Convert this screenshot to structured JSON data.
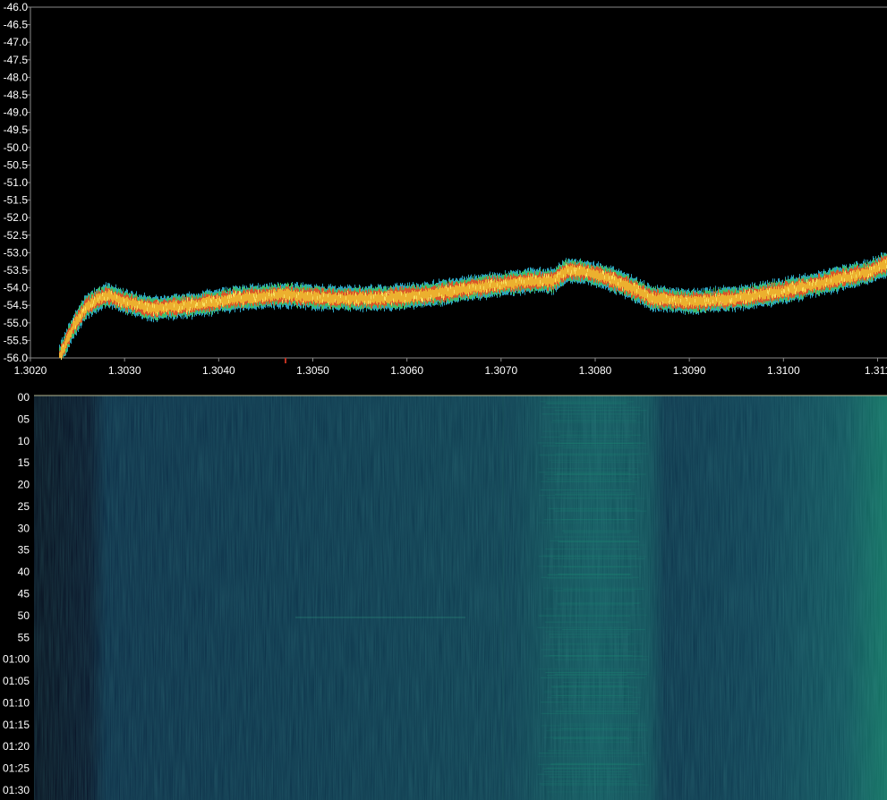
{
  "spectrum": {
    "y_ticks": [
      "-46.0",
      "-46.5",
      "-47.0",
      "-47.5",
      "-48.0",
      "-48.5",
      "-49.0",
      "-49.5",
      "-50.0",
      "-50.5",
      "-51.0",
      "-51.5",
      "-52.0",
      "-52.5",
      "-53.0",
      "-53.5",
      "-54.0",
      "-54.5",
      "-55.0",
      "-55.5",
      "-56.0"
    ],
    "x_ticks": [
      "1.3020",
      "1.3030",
      "1.3040",
      "1.3050",
      "1.3060",
      "1.3070",
      "1.3080",
      "1.3090",
      "1.3100",
      "1.311"
    ],
    "trace_colors": [
      "#d8552a",
      "#f0c030",
      "#f7e060",
      "#3dbf6a",
      "#2aa0c0"
    ]
  },
  "waterfall": {
    "time_labels": [
      "00",
      "05",
      "10",
      "15",
      "20",
      "25",
      "30",
      "35",
      "40",
      "45",
      "50",
      "55",
      "01:00",
      "01:05",
      "01:10",
      "01:15",
      "01:20",
      "01:25",
      "01:30"
    ],
    "colors": [
      "#0a1a33",
      "#0b2a44",
      "#0f4a55",
      "#127060"
    ]
  },
  "chart_data": [
    {
      "type": "line",
      "title": "",
      "xlabel": "",
      "ylabel": "",
      "xlim": [
        1.302,
        1.3111
      ],
      "ylim": [
        -56.0,
        -46.0
      ],
      "grid": false,
      "series": [
        {
          "x": [
            1.3023,
            1.30245,
            1.3026,
            1.3028,
            1.303,
            1.3033,
            1.3037,
            1.3042,
            1.3047,
            1.3052,
            1.3057,
            1.3062,
            1.3067,
            1.307,
            1.3073,
            1.30755,
            1.3077,
            1.3079,
            1.3081,
            1.3083,
            1.3086,
            1.309,
            1.3095,
            1.31,
            1.3105,
            1.3109,
            1.3111
          ],
          "y": [
            -56.0,
            -55.1,
            -54.5,
            -54.2,
            -54.4,
            -54.6,
            -54.5,
            -54.3,
            -54.2,
            -54.3,
            -54.3,
            -54.2,
            -54.0,
            -53.9,
            -53.8,
            -53.8,
            -53.5,
            -53.55,
            -53.7,
            -53.9,
            -54.3,
            -54.4,
            -54.3,
            -54.1,
            -53.8,
            -53.55,
            -53.3
          ]
        }
      ]
    },
    {
      "type": "heatmap",
      "title": "",
      "xlabel": "",
      "ylabel": "",
      "xlim": [
        1.302,
        1.3111
      ],
      "y_categories": [
        "00",
        "05",
        "10",
        "15",
        "20",
        "25",
        "30",
        "35",
        "40",
        "45",
        "50",
        "55",
        "01:00",
        "01:05",
        "01:10",
        "01:15",
        "01:20",
        "01:25",
        "01:30"
      ]
    }
  ]
}
